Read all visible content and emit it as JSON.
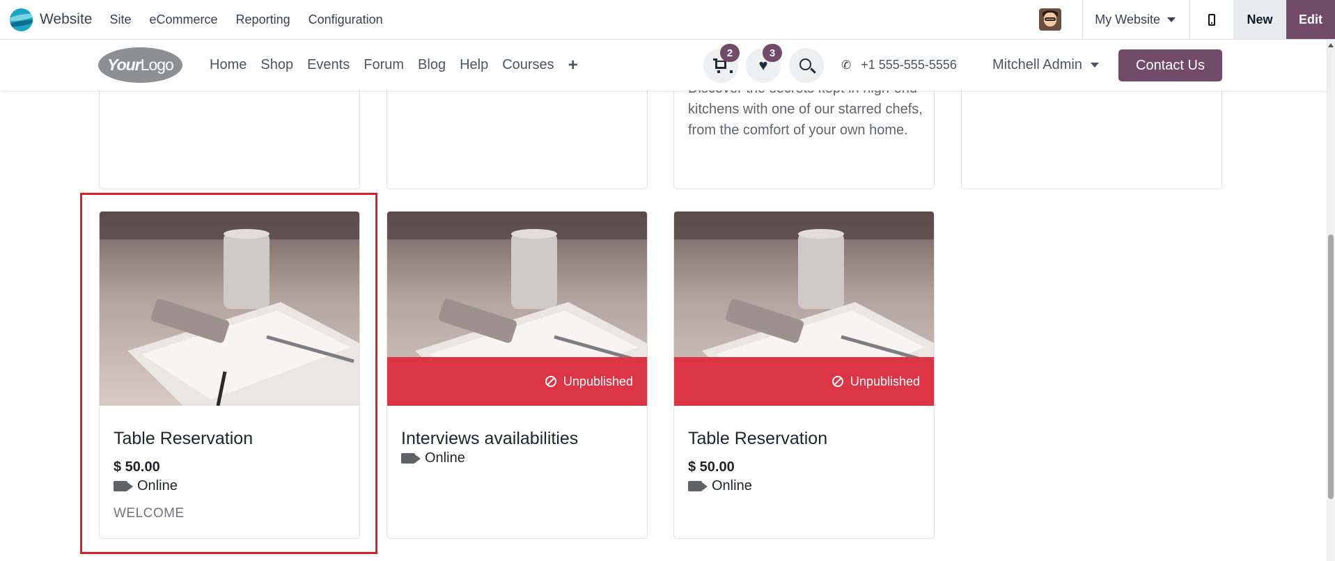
{
  "odoo_bar": {
    "app_name": "Website",
    "menu": [
      "Site",
      "eCommerce",
      "Reporting",
      "Configuration"
    ],
    "website_selector": "My Website",
    "new_label": "New",
    "edit_label": "Edit"
  },
  "site_header": {
    "logo_bold": "Your",
    "logo_light": "Logo",
    "nav": [
      "Home",
      "Shop",
      "Events",
      "Forum",
      "Blog",
      "Help",
      "Courses"
    ],
    "add_menu_icon": "plus-icon",
    "cart_count": "2",
    "wishlist_count": "3",
    "phone": "+1 555-555-5556",
    "user_name": "Mitchell Admin",
    "contact_label": "Contact Us"
  },
  "previous_row": {
    "description": "Discover the secrets kept in high-end kitchens with one of our starred chefs, from the comfort of your own home."
  },
  "cards": [
    {
      "title": "Table Reservation",
      "price": "$ 50.00",
      "location": "Online",
      "tag": "WELCOME",
      "unpublished": false
    },
    {
      "title": "Interviews availabilities",
      "location": "Online",
      "unpublished": true,
      "status": "Unpublished"
    },
    {
      "title": "Table Reservation",
      "price": "$ 50.00",
      "location": "Online",
      "unpublished": true,
      "status": "Unpublished"
    }
  ],
  "colors": {
    "brand": "#714b67",
    "unpublished": "#dc3545",
    "highlight": "#dc1f26"
  }
}
